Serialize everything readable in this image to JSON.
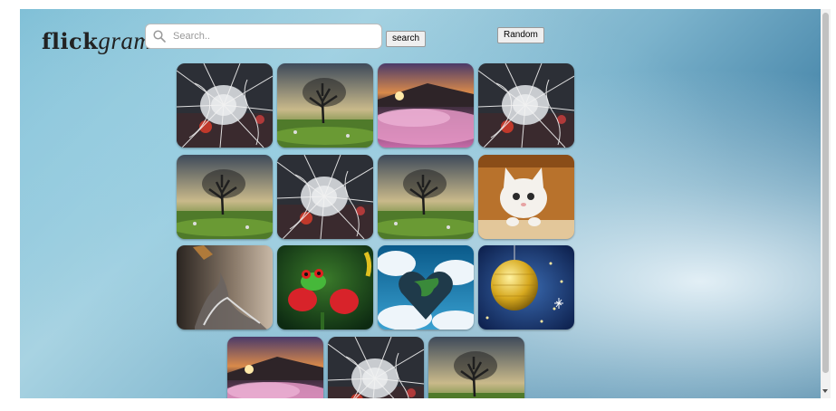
{
  "logo": {
    "bold": "flick",
    "italic": "gram"
  },
  "search": {
    "placeholder": "Search.."
  },
  "buttons": {
    "search": "search",
    "random": "Random"
  },
  "icons": {
    "search": "search-icon"
  },
  "colors": {
    "background": "#7cb3cc"
  },
  "gallery": [
    {
      "row": 0,
      "col": 0,
      "subject": "shattered-glass"
    },
    {
      "row": 0,
      "col": 1,
      "subject": "tree-landscape"
    },
    {
      "row": 0,
      "col": 2,
      "subject": "sunset-clouds"
    },
    {
      "row": 0,
      "col": 3,
      "subject": "shattered-glass"
    },
    {
      "row": 1,
      "col": 0,
      "subject": "tree-landscape"
    },
    {
      "row": 1,
      "col": 1,
      "subject": "shattered-glass"
    },
    {
      "row": 1,
      "col": 2,
      "subject": "tree-landscape"
    },
    {
      "row": 1,
      "col": 3,
      "subject": "white-kitten"
    },
    {
      "row": 2,
      "col": 0,
      "subject": "dragon-fantasy"
    },
    {
      "row": 2,
      "col": 1,
      "subject": "frog-on-flower"
    },
    {
      "row": 2,
      "col": 2,
      "subject": "earth-heart-clouds"
    },
    {
      "row": 2,
      "col": 3,
      "subject": "golden-ornament"
    },
    {
      "row": 3,
      "col": 0,
      "subject": "sunset-clouds"
    },
    {
      "row": 3,
      "col": 1,
      "subject": "shattered-glass"
    },
    {
      "row": 3,
      "col": 2,
      "subject": "tree-landscape"
    }
  ]
}
